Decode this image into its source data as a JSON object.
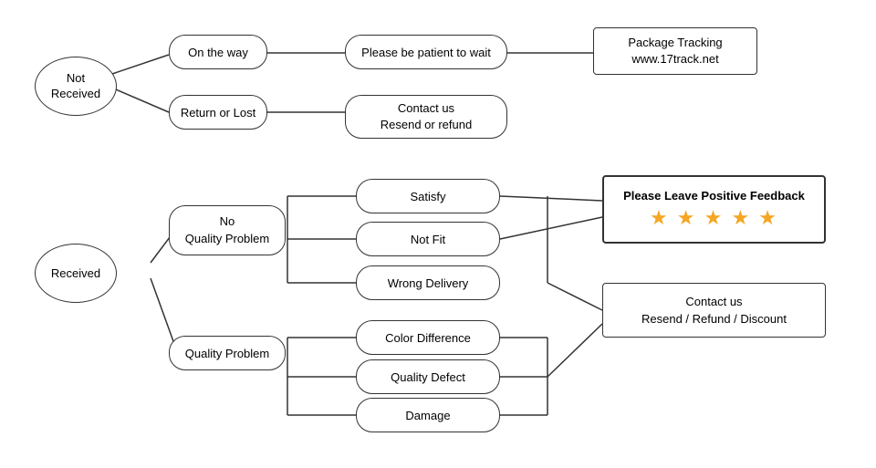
{
  "nodes": {
    "not_received": "Not\nReceived",
    "received": "Received",
    "on_the_way": "On the way",
    "return_or_lost": "Return or Lost",
    "patient": "Please be patient to wait",
    "package_tracking": "Package Tracking\nwww.17track.net",
    "contact_us_resend": "Contact us\nResend or refund",
    "no_quality_problem": "No\nQuality Problem",
    "quality_problem": "Quality Problem",
    "satisfy": "Satisfy",
    "not_fit": "Not Fit",
    "wrong_delivery": "Wrong Delivery",
    "color_difference": "Color Difference",
    "quality_defect": "Quality Defect",
    "damage": "Damage",
    "please_leave_feedback": "Please Leave Positive Feedback",
    "stars": "★ ★ ★ ★ ★",
    "contact_us_resend2": "Contact us\nResend / Refund / Discount"
  }
}
